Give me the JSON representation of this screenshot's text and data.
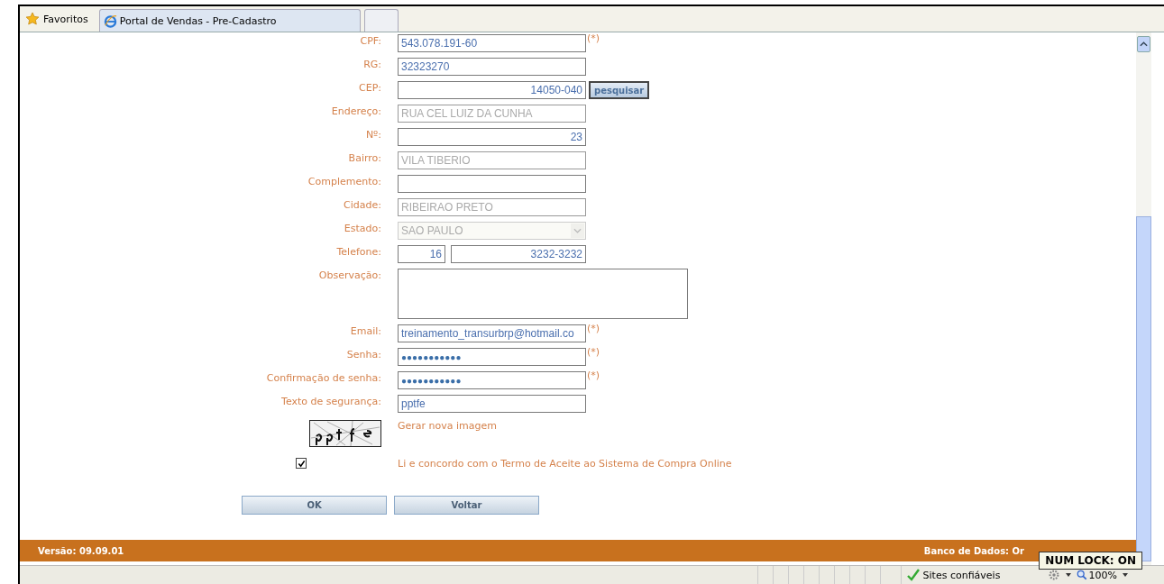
{
  "browser": {
    "favorites": "Favoritos",
    "tabs": [
      {
        "label": "Portal de Vendas - Pre-Cadastro",
        "selected": true
      },
      {
        "selected": false
      }
    ]
  },
  "form": {
    "fields": [
      {
        "label": "CPF:",
        "kind": "text",
        "value": "543.078.191-60",
        "disabled": false,
        "required_mark": "(*)"
      },
      {
        "label": "RG:",
        "kind": "text",
        "value": "32323270",
        "disabled": false
      },
      {
        "label": "CEP:",
        "kind": "number",
        "value": "14050-040",
        "disabled": false,
        "button": "pesquisar"
      },
      {
        "label": "Endereço:",
        "kind": "text",
        "value": "RUA CEL LUIZ DA CUNHA",
        "disabled": true
      },
      {
        "label": "Nº:",
        "kind": "number",
        "value": "23",
        "disabled": false
      },
      {
        "label": "Bairro:",
        "kind": "text",
        "value": "VILA TIBERIO",
        "disabled": true
      },
      {
        "label": "Complemento:",
        "kind": "text",
        "disabled": false
      },
      {
        "label": "Cidade:",
        "kind": "text",
        "value": "RIBEIRAO PRETO",
        "disabled": true
      },
      {
        "label": "Estado:",
        "kind": "select",
        "value": "SAO PAULO",
        "disabled": true
      },
      {
        "label": "Telefone:",
        "kind": "phone",
        "area_code": "16",
        "value": "3232-3232",
        "disabled": false
      },
      {
        "label": "Observação:",
        "kind": "textarea",
        "disabled": false
      },
      {
        "label": "Email:",
        "kind": "text",
        "value": "treinamento_transurbrp@hotmail.co",
        "disabled": false,
        "required_mark": "(*)"
      },
      {
        "label": "Senha:",
        "kind": "password",
        "value": "●●●●●●●●●●●",
        "disabled": false,
        "required_mark": "(*)"
      },
      {
        "label": "Confirmação de senha:",
        "kind": "password",
        "value": "●●●●●●●●●●●",
        "disabled": false,
        "required_mark": "(*)"
      },
      {
        "label": "Texto de segurança:",
        "kind": "text",
        "value": "pptfe",
        "disabled": false
      }
    ],
    "captcha_link": "Gerar nova imagem",
    "terms": {
      "checked": true,
      "label": "Li e concordo com o Termo de Aceite ao Sistema de Compra Online"
    },
    "buttons": [
      "OK",
      "Voltar"
    ]
  },
  "footer": {
    "version": "Versão: 09.09.01",
    "database": "Banco de Dados: Or"
  },
  "tooltip": "NUM LOCK: ON",
  "status_bar": {
    "zone": "Sites confiáveis",
    "zoom": "100%"
  }
}
